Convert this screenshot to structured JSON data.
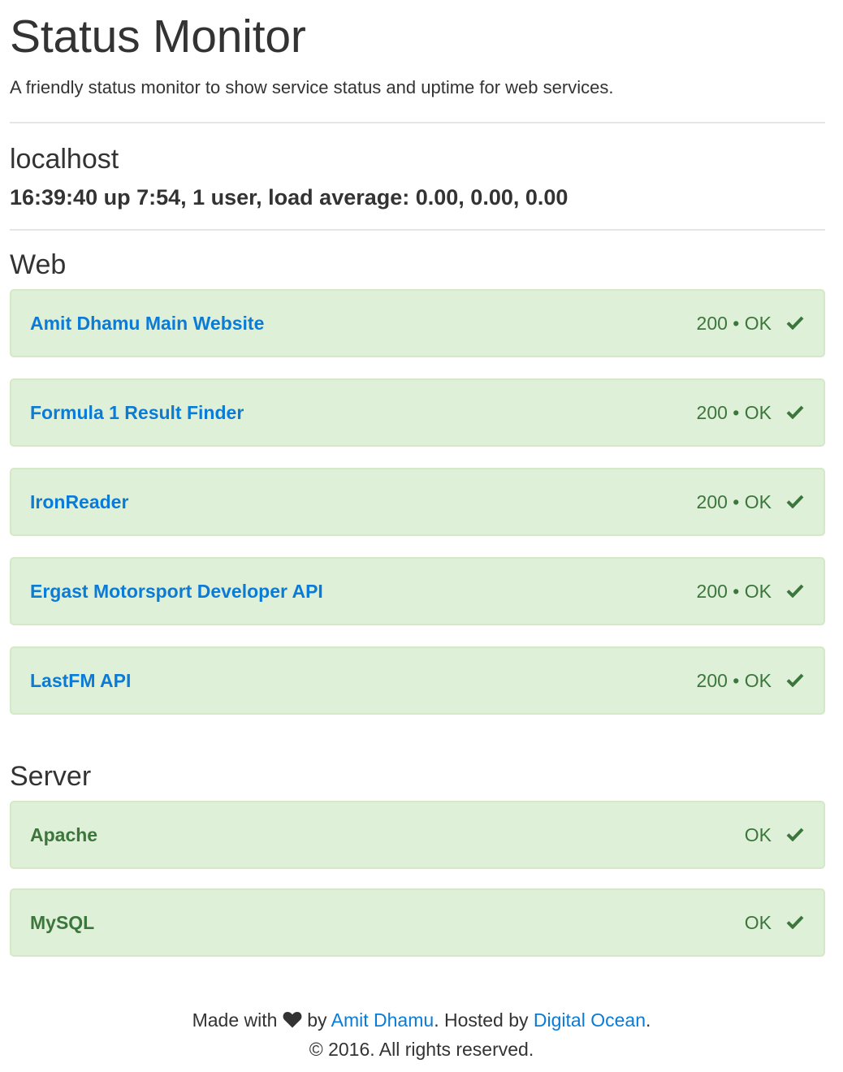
{
  "header": {
    "title": "Status Monitor",
    "subtitle": "A friendly status monitor to show service status and uptime for web services."
  },
  "host": {
    "name": "localhost",
    "uptime": "16:39:40 up 7:54, 1 user, load average: 0.00, 0.00, 0.00"
  },
  "sections": {
    "web": {
      "title": "Web",
      "services": [
        {
          "name": "Amit Dhamu Main Website",
          "status": "200 • OK",
          "icon": "check-icon"
        },
        {
          "name": "Formula 1 Result Finder",
          "status": "200 • OK",
          "icon": "check-icon"
        },
        {
          "name": "IronReader",
          "status": "200 • OK",
          "icon": "check-icon"
        },
        {
          "name": "Ergast Motorsport Developer API",
          "status": "200 • OK",
          "icon": "check-icon"
        },
        {
          "name": "LastFM API",
          "status": "200 • OK",
          "icon": "check-icon"
        }
      ]
    },
    "server": {
      "title": "Server",
      "services": [
        {
          "name": "Apache",
          "status": "OK",
          "icon": "check-icon"
        },
        {
          "name": "MySQL",
          "status": "OK",
          "icon": "check-icon"
        }
      ]
    }
  },
  "footer": {
    "made_with": "Made with",
    "by": "by",
    "author": "Amit Dhamu",
    "hosted_by": ". Hosted by",
    "host_link": "Digital Ocean",
    "period": ".",
    "copyright": "© 2016. All rights reserved.",
    "icon": "heart-icon"
  },
  "colors": {
    "success_bg": "#dff0d8",
    "success_border": "#d6e9c6",
    "success_text": "#3c763d",
    "link": "#0a7bd6",
    "text": "#333333"
  }
}
